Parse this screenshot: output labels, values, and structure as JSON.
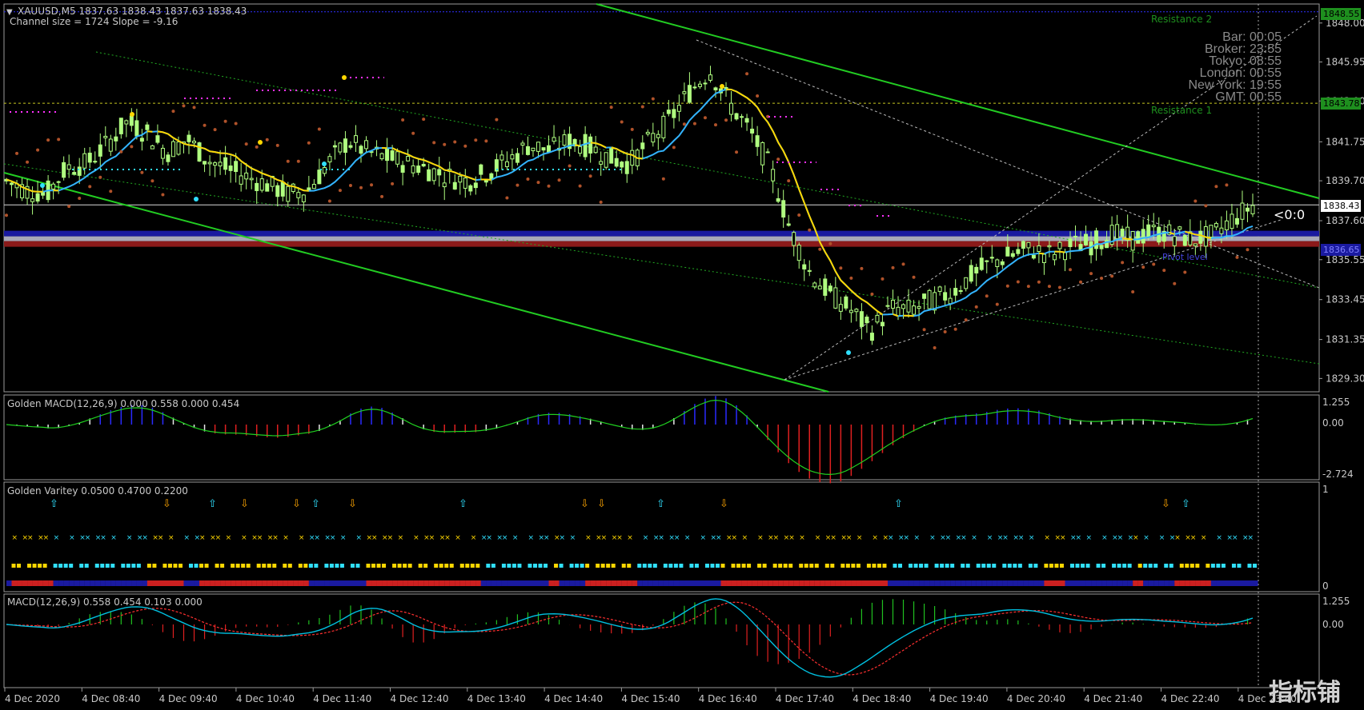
{
  "symbol_header": "XAUUSD,M5  1837.63 1838.43 1837.63 1838.43",
  "channel_info": "Channel size = 1724 Slope = -9.16",
  "clock": {
    "bar": "Bar: 00:05",
    "broker": "Broker: 23:55",
    "tokyo": "Tokyo: 08:55",
    "london": "London: 00:55",
    "newyork": "New York: 19:55",
    "gmt": "GMT: 00:55"
  },
  "resistance_labels": [
    "Resistance 2",
    "Resistance 1"
  ],
  "pivot_label": "Pivot level",
  "arrow_marker": "<0:0",
  "price_tags": {
    "r2": "1848.55",
    "r1": "1843.78",
    "current": "1838.43",
    "pivot": "1836.65"
  },
  "colors": {
    "candle": "#b0ff80",
    "channel": "#22cc22",
    "ma_blue": "#33b4ff",
    "ma_yellow": "#ffd700",
    "sar": "#b0522a",
    "pivot_red": "#8b1a1a",
    "pivot_blue": "#1a1aa0",
    "macd_signal": "#00c0e0",
    "macd_dash": "#ff3030"
  },
  "watermark": "指标铺",
  "panels": {
    "golden_macd": {
      "label": "Golden MACD(12,26,9) 0.000 0.558 0.000 0.454",
      "ticks": [
        "1.255",
        "0.00",
        "-2.724"
      ]
    },
    "golden_variety": {
      "label": "Golden Varitey 0.0500 0.4700 0.2200",
      "ticks": [
        "1",
        "0"
      ]
    },
    "macd": {
      "label": "MACD(12,26,9) 0.558 0.454 0.103 0.000",
      "ticks": [
        "1.255",
        "0.00"
      ]
    }
  },
  "chart_data": {
    "type": "candlestick",
    "symbol": "XAUUSD",
    "timeframe": "M5",
    "ohlc_last": {
      "open": 1837.63,
      "high": 1838.43,
      "low": 1837.63,
      "close": 1838.43
    },
    "y_ticks": [
      1848.0,
      1845.95,
      1843.9,
      1841.75,
      1839.7,
      1837.6,
      1835.55,
      1833.45,
      1831.35,
      1829.3
    ],
    "ylim": [
      1828.6,
      1849.0
    ],
    "x_tick_labels": [
      "4 Dec 2020",
      "4 Dec 08:40",
      "4 Dec 09:40",
      "4 Dec 10:40",
      "4 Dec 11:40",
      "4 Dec 12:40",
      "4 Dec 13:40",
      "4 Dec 14:40",
      "4 Dec 15:40",
      "4 Dec 16:40",
      "4 Dec 17:40",
      "4 Dec 18:40",
      "4 Dec 19:40",
      "4 Dec 20:40",
      "4 Dec 21:40",
      "4 Dec 22:40",
      "4 Dec 23:40"
    ],
    "levels": {
      "resistance_2": 1848.55,
      "resistance_1": 1843.78,
      "current": 1838.43,
      "pivot": 1836.65
    },
    "close_path": [
      1839.7,
      1839.2,
      1839.0,
      1840.4,
      1840.6,
      1841.6,
      1842.8,
      1842.2,
      1841.2,
      1841.9,
      1840.8,
      1840.3,
      1839.9,
      1839.5,
      1839.0,
      1839.2,
      1840.6,
      1841.8,
      1841.2,
      1840.9,
      1840.6,
      1840.3,
      1839.9,
      1839.7,
      1840.2,
      1840.8,
      1841.6,
      1841.3,
      1841.8,
      1841.5,
      1840.9,
      1840.6,
      1841.8,
      1842.9,
      1844.4,
      1845.5,
      1843.7,
      1842.3,
      1840.4,
      1837.1,
      1834.8,
      1833.7,
      1832.9,
      1831.8,
      1833.0,
      1832.9,
      1833.4,
      1833.8,
      1834.7,
      1835.4,
      1835.8,
      1836.1,
      1835.8,
      1836.3,
      1836.4,
      1836.9,
      1836.6,
      1837.0,
      1836.9,
      1836.6,
      1836.8,
      1837.7,
      1838.4
    ],
    "series": [
      {
        "name": "Golden MACD(12,26,9)",
        "values": [
          0.0,
          0.558,
          0.0,
          0.454
        ]
      },
      {
        "name": "Golden Varitey",
        "values": [
          0.05,
          0.47,
          0.22
        ]
      },
      {
        "name": "MACD(12,26,9)",
        "values": [
          0.558,
          0.454,
          0.103,
          0.0
        ]
      }
    ]
  }
}
